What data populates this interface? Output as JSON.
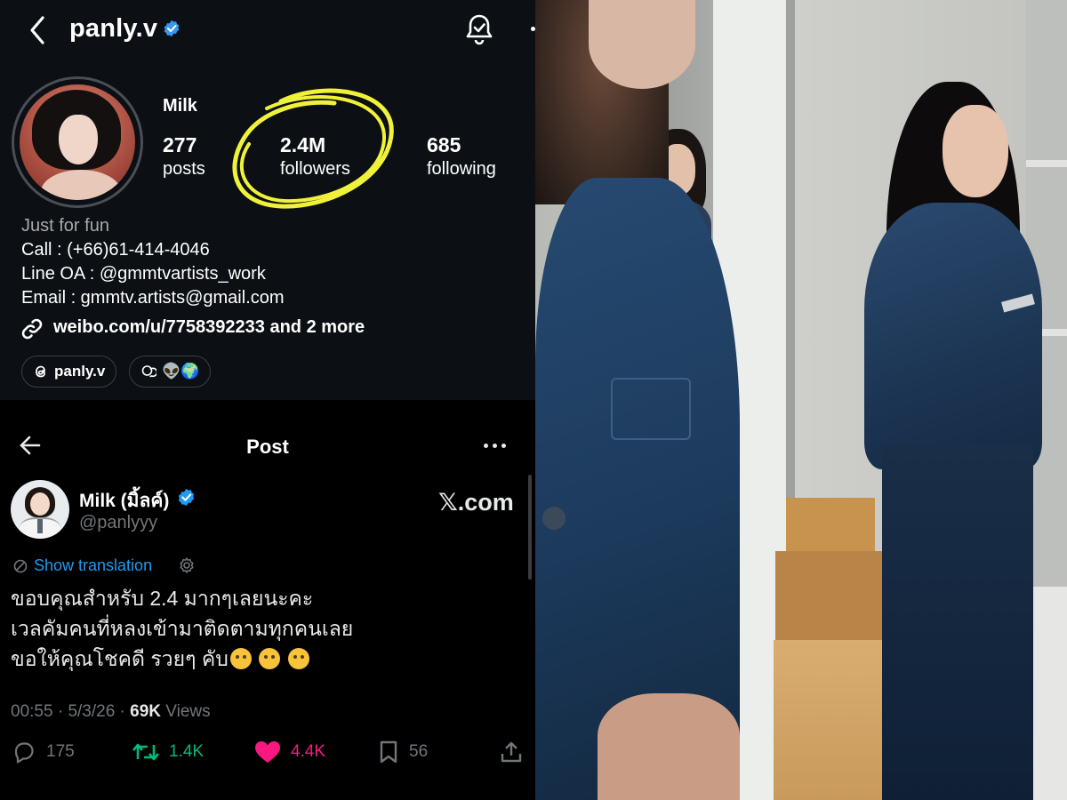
{
  "instagram": {
    "username": "panly.v",
    "display_name": "Milk",
    "stats": [
      {
        "value": "277",
        "label": "posts"
      },
      {
        "value": "2.4M",
        "label": "followers"
      },
      {
        "value": "685",
        "label": "following"
      }
    ],
    "bio": [
      "Just for fun",
      "Call : (+66)61-414-4046",
      "Line OA : @gmmtvartists_work",
      "Email : gmmtv.artists@gmail.com"
    ],
    "link": "weibo.com/u/7758392233 and 2 more",
    "chips": {
      "threads": "panly.v",
      "second": "👽🌍"
    },
    "highlight_color": "#f0f23a",
    "verified_color": "#3897f0"
  },
  "xpost": {
    "header_title": "Post",
    "author_name": "Milk (มิ้ลค์)",
    "author_handle": "@panlyyy",
    "brand": "𝕏.com",
    "show_translation": "Show translation",
    "text_lines": [
      "ขอบคุณสำหรับ 2.4 มากๆเลยนะคะ",
      "เวลคัมคนที่หลงเข้ามาติดตามทุกคนเลย",
      "ขอให้คุณโชคดี รวยๆ คับ"
    ],
    "emoji_count": 3,
    "meta": {
      "time": "00:55",
      "date": "5/3/26",
      "views_count": "69K",
      "views_label": "Views"
    },
    "actions": {
      "replies": "175",
      "reposts": "1.4K",
      "likes": "4.4K",
      "bookmarks": "56"
    },
    "colors": {
      "repost": "#00ba7c",
      "like": "#f91880",
      "link": "#1d9bf0",
      "muted": "#71767b"
    }
  }
}
